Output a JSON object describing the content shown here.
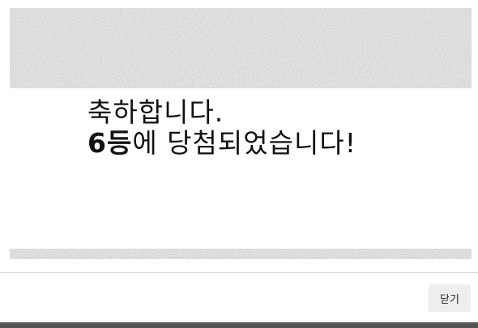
{
  "result": {
    "line1": "축하합니다.",
    "rank": "6등",
    "line2_rest": "에 당첨되었습니다!"
  },
  "footer": {
    "close_label": "닫기"
  },
  "colors": {
    "scratch_overlay": "#c4c4c4",
    "bottom_bar": "#555555",
    "close_button_bg": "#eeeeee"
  }
}
